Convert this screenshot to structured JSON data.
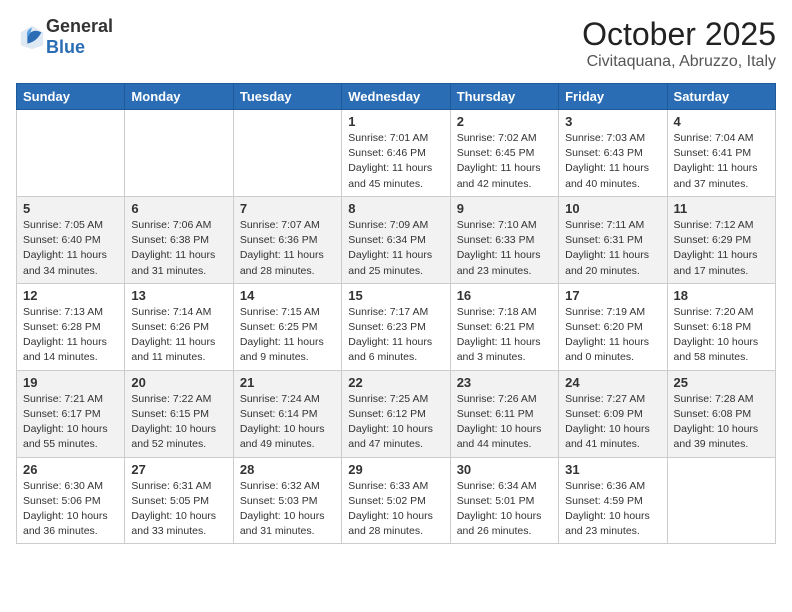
{
  "header": {
    "logo_general": "General",
    "logo_blue": "Blue",
    "month_title": "October 2025",
    "location": "Civitaquana, Abruzzo, Italy"
  },
  "days_of_week": [
    "Sunday",
    "Monday",
    "Tuesday",
    "Wednesday",
    "Thursday",
    "Friday",
    "Saturday"
  ],
  "weeks": [
    [
      {
        "date": "",
        "info": ""
      },
      {
        "date": "",
        "info": ""
      },
      {
        "date": "",
        "info": ""
      },
      {
        "date": "1",
        "info": "Sunrise: 7:01 AM\nSunset: 6:46 PM\nDaylight: 11 hours and 45 minutes."
      },
      {
        "date": "2",
        "info": "Sunrise: 7:02 AM\nSunset: 6:45 PM\nDaylight: 11 hours and 42 minutes."
      },
      {
        "date": "3",
        "info": "Sunrise: 7:03 AM\nSunset: 6:43 PM\nDaylight: 11 hours and 40 minutes."
      },
      {
        "date": "4",
        "info": "Sunrise: 7:04 AM\nSunset: 6:41 PM\nDaylight: 11 hours and 37 minutes."
      }
    ],
    [
      {
        "date": "5",
        "info": "Sunrise: 7:05 AM\nSunset: 6:40 PM\nDaylight: 11 hours and 34 minutes."
      },
      {
        "date": "6",
        "info": "Sunrise: 7:06 AM\nSunset: 6:38 PM\nDaylight: 11 hours and 31 minutes."
      },
      {
        "date": "7",
        "info": "Sunrise: 7:07 AM\nSunset: 6:36 PM\nDaylight: 11 hours and 28 minutes."
      },
      {
        "date": "8",
        "info": "Sunrise: 7:09 AM\nSunset: 6:34 PM\nDaylight: 11 hours and 25 minutes."
      },
      {
        "date": "9",
        "info": "Sunrise: 7:10 AM\nSunset: 6:33 PM\nDaylight: 11 hours and 23 minutes."
      },
      {
        "date": "10",
        "info": "Sunrise: 7:11 AM\nSunset: 6:31 PM\nDaylight: 11 hours and 20 minutes."
      },
      {
        "date": "11",
        "info": "Sunrise: 7:12 AM\nSunset: 6:29 PM\nDaylight: 11 hours and 17 minutes."
      }
    ],
    [
      {
        "date": "12",
        "info": "Sunrise: 7:13 AM\nSunset: 6:28 PM\nDaylight: 11 hours and 14 minutes."
      },
      {
        "date": "13",
        "info": "Sunrise: 7:14 AM\nSunset: 6:26 PM\nDaylight: 11 hours and 11 minutes."
      },
      {
        "date": "14",
        "info": "Sunrise: 7:15 AM\nSunset: 6:25 PM\nDaylight: 11 hours and 9 minutes."
      },
      {
        "date": "15",
        "info": "Sunrise: 7:17 AM\nSunset: 6:23 PM\nDaylight: 11 hours and 6 minutes."
      },
      {
        "date": "16",
        "info": "Sunrise: 7:18 AM\nSunset: 6:21 PM\nDaylight: 11 hours and 3 minutes."
      },
      {
        "date": "17",
        "info": "Sunrise: 7:19 AM\nSunset: 6:20 PM\nDaylight: 11 hours and 0 minutes."
      },
      {
        "date": "18",
        "info": "Sunrise: 7:20 AM\nSunset: 6:18 PM\nDaylight: 10 hours and 58 minutes."
      }
    ],
    [
      {
        "date": "19",
        "info": "Sunrise: 7:21 AM\nSunset: 6:17 PM\nDaylight: 10 hours and 55 minutes."
      },
      {
        "date": "20",
        "info": "Sunrise: 7:22 AM\nSunset: 6:15 PM\nDaylight: 10 hours and 52 minutes."
      },
      {
        "date": "21",
        "info": "Sunrise: 7:24 AM\nSunset: 6:14 PM\nDaylight: 10 hours and 49 minutes."
      },
      {
        "date": "22",
        "info": "Sunrise: 7:25 AM\nSunset: 6:12 PM\nDaylight: 10 hours and 47 minutes."
      },
      {
        "date": "23",
        "info": "Sunrise: 7:26 AM\nSunset: 6:11 PM\nDaylight: 10 hours and 44 minutes."
      },
      {
        "date": "24",
        "info": "Sunrise: 7:27 AM\nSunset: 6:09 PM\nDaylight: 10 hours and 41 minutes."
      },
      {
        "date": "25",
        "info": "Sunrise: 7:28 AM\nSunset: 6:08 PM\nDaylight: 10 hours and 39 minutes."
      }
    ],
    [
      {
        "date": "26",
        "info": "Sunrise: 6:30 AM\nSunset: 5:06 PM\nDaylight: 10 hours and 36 minutes."
      },
      {
        "date": "27",
        "info": "Sunrise: 6:31 AM\nSunset: 5:05 PM\nDaylight: 10 hours and 33 minutes."
      },
      {
        "date": "28",
        "info": "Sunrise: 6:32 AM\nSunset: 5:03 PM\nDaylight: 10 hours and 31 minutes."
      },
      {
        "date": "29",
        "info": "Sunrise: 6:33 AM\nSunset: 5:02 PM\nDaylight: 10 hours and 28 minutes."
      },
      {
        "date": "30",
        "info": "Sunrise: 6:34 AM\nSunset: 5:01 PM\nDaylight: 10 hours and 26 minutes."
      },
      {
        "date": "31",
        "info": "Sunrise: 6:36 AM\nSunset: 4:59 PM\nDaylight: 10 hours and 23 minutes."
      },
      {
        "date": "",
        "info": ""
      }
    ]
  ]
}
